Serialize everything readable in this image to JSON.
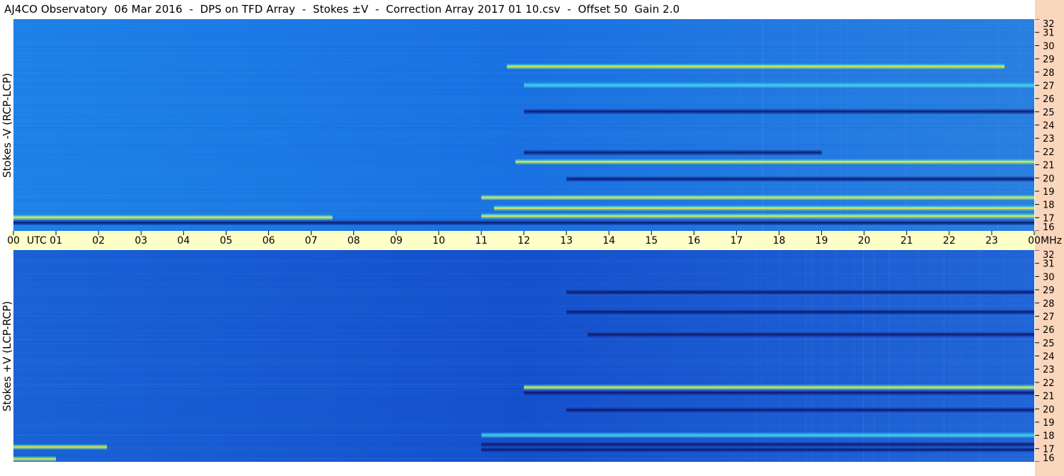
{
  "title": "AJ4CO Observatory  06 Mar 2016  -  DPS on TFD Array  -  Stokes ±V  -  Correction Array 2017 01 10.csv  -  Offset 50  Gain 2.0",
  "panels": {
    "top_label": "Stokes -V (RCP-LCP)",
    "bottom_label": "Stokes +V (LCP-RCP)"
  },
  "colors": {
    "background_blue": "#1a78e6",
    "deep_blue": "#1448c8",
    "time_bar": "#ffffc8",
    "freq_bar": "#f9d6bc"
  },
  "chart_data": [
    {
      "type": "heatmap",
      "name": "Stokes -V (RCP-LCP)",
      "xlabel": "UTC",
      "ylabel": "MHz",
      "x_ticks": [
        "00",
        "01",
        "02",
        "03",
        "04",
        "05",
        "06",
        "07",
        "08",
        "09",
        "10",
        "11",
        "12",
        "13",
        "14",
        "15",
        "16",
        "17",
        "18",
        "19",
        "20",
        "21",
        "22",
        "23",
        "00"
      ],
      "y_ticks": [
        16,
        17,
        18,
        19,
        20,
        21,
        22,
        23,
        24,
        25,
        26,
        27,
        28,
        29,
        30,
        31,
        32
      ],
      "xlim": [
        0,
        24
      ],
      "ylim": [
        16,
        32
      ],
      "bands": [
        {
          "start": 11.6,
          "end": 23.3,
          "freq": 28.4,
          "intensity": "yellow"
        },
        {
          "start": 12.0,
          "end": 24.0,
          "freq": 27.0,
          "intensity": "cyan"
        },
        {
          "start": 12.0,
          "end": 24.0,
          "freq": 25.0,
          "intensity": "dark"
        },
        {
          "start": 12.0,
          "end": 19.0,
          "freq": 21.9,
          "intensity": "dark"
        },
        {
          "start": 11.8,
          "end": 24.0,
          "freq": 21.2,
          "intensity": "yellow"
        },
        {
          "start": 13.0,
          "end": 24.0,
          "freq": 19.9,
          "intensity": "dark"
        },
        {
          "start": 11.0,
          "end": 24.0,
          "freq": 18.5,
          "intensity": "yellow"
        },
        {
          "start": 11.3,
          "end": 24.0,
          "freq": 17.7,
          "intensity": "yellow"
        },
        {
          "start": 0.0,
          "end": 7.5,
          "freq": 17.0,
          "intensity": "yellow"
        },
        {
          "start": 11.0,
          "end": 24.0,
          "freq": 17.1,
          "intensity": "yellow"
        },
        {
          "start": 0.0,
          "end": 24.0,
          "freq": 16.6,
          "intensity": "dark"
        }
      ]
    },
    {
      "type": "heatmap",
      "name": "Stokes +V (LCP-RCP)",
      "xlabel": "UTC",
      "ylabel": "MHz",
      "x_ticks": [
        "00",
        "01",
        "02",
        "03",
        "04",
        "05",
        "06",
        "07",
        "08",
        "09",
        "10",
        "11",
        "12",
        "13",
        "14",
        "15",
        "16",
        "17",
        "18",
        "19",
        "20",
        "21",
        "22",
        "23",
        "00"
      ],
      "y_ticks": [
        16,
        17,
        18,
        19,
        20,
        21,
        22,
        23,
        24,
        25,
        26,
        27,
        28,
        29,
        30,
        31,
        32
      ],
      "xlim": [
        0,
        24
      ],
      "ylim": [
        16,
        32
      ],
      "bands": [
        {
          "start": 13.0,
          "end": 24.0,
          "freq": 28.8,
          "intensity": "dark"
        },
        {
          "start": 13.0,
          "end": 24.0,
          "freq": 27.3,
          "intensity": "dark"
        },
        {
          "start": 13.5,
          "end": 24.0,
          "freq": 25.6,
          "intensity": "dark"
        },
        {
          "start": 12.0,
          "end": 24.0,
          "freq": 21.6,
          "intensity": "yellow"
        },
        {
          "start": 12.0,
          "end": 24.0,
          "freq": 21.2,
          "intensity": "dark"
        },
        {
          "start": 13.0,
          "end": 24.0,
          "freq": 19.9,
          "intensity": "dark"
        },
        {
          "start": 11.0,
          "end": 24.0,
          "freq": 18.0,
          "intensity": "cyan"
        },
        {
          "start": 11.0,
          "end": 24.0,
          "freq": 17.3,
          "intensity": "dark"
        },
        {
          "start": 0.0,
          "end": 2.2,
          "freq": 17.1,
          "intensity": "yellow"
        },
        {
          "start": 11.0,
          "end": 24.0,
          "freq": 16.9,
          "intensity": "dark"
        },
        {
          "start": 0.0,
          "end": 1.0,
          "freq": 16.2,
          "intensity": "yellow"
        }
      ]
    }
  ],
  "time_axis": {
    "unit_label": "UTC",
    "end_unit": "MHz"
  }
}
